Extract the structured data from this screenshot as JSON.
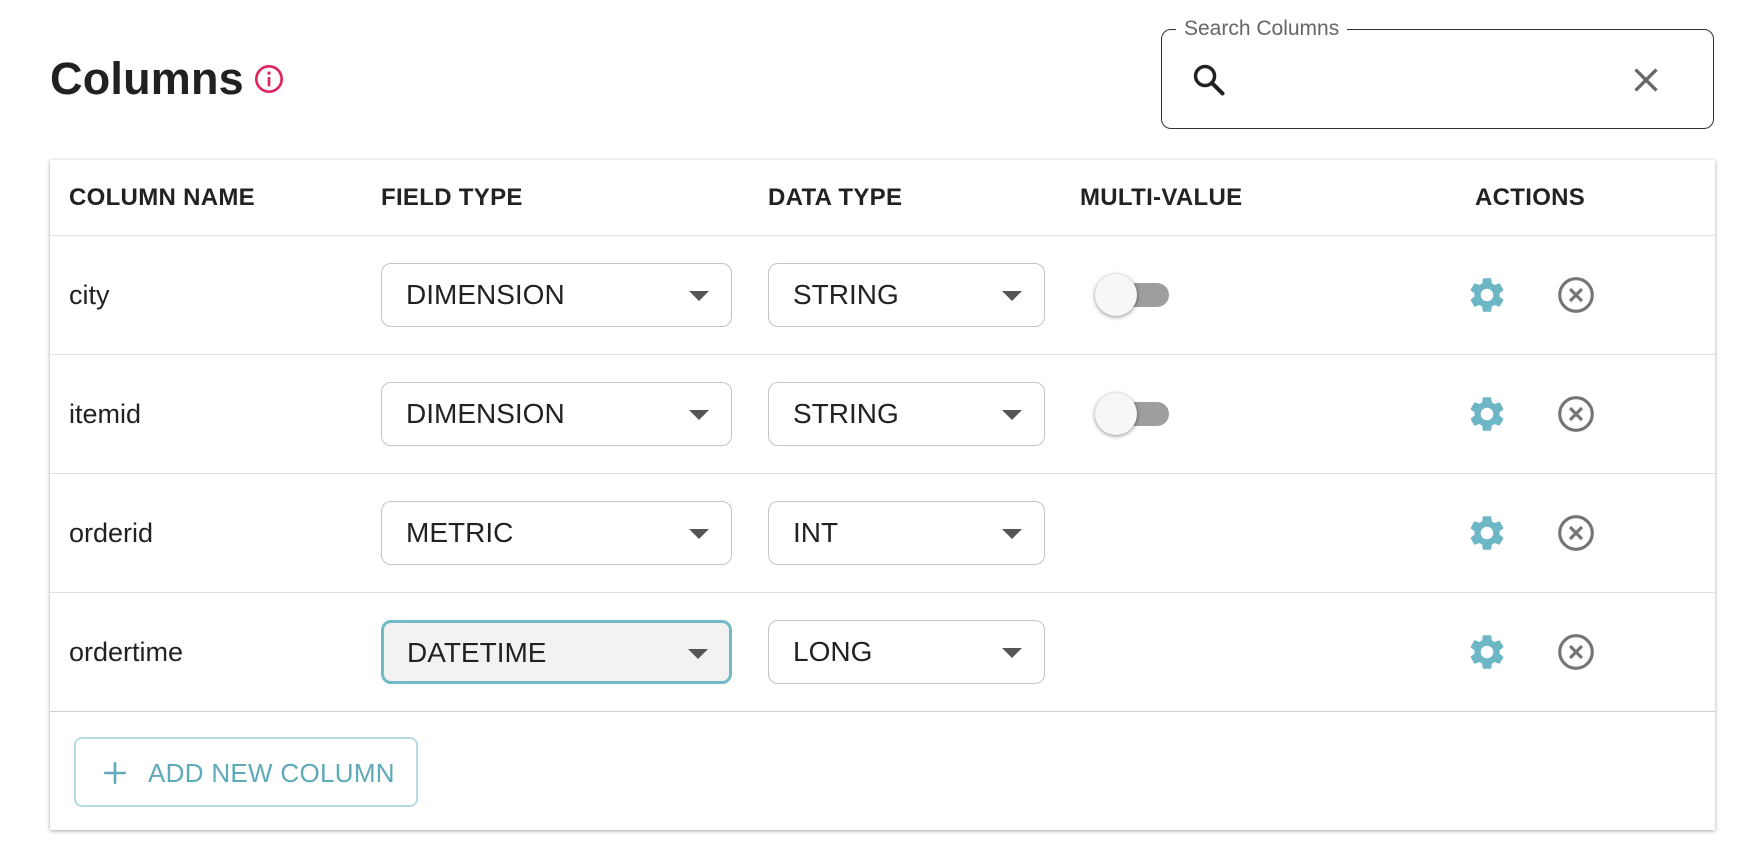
{
  "header": {
    "title": "Columns",
    "info_icon": "info-circle-icon"
  },
  "search": {
    "label": "Search Columns",
    "value": "",
    "placeholder": ""
  },
  "colors": {
    "accent": "#5eaab9",
    "info": "#e0245e",
    "toggle_off": "#9e9e9e"
  },
  "table": {
    "headers": {
      "column_name": "COLUMN NAME",
      "field_type": "FIELD TYPE",
      "data_type": "DATA TYPE",
      "multi_value": "MULTI-VALUE",
      "actions": "ACTIONS"
    },
    "rows": [
      {
        "name": "city",
        "field_type": "DIMENSION",
        "data_type": "STRING",
        "multi_value": false,
        "has_multi_value": true
      },
      {
        "name": "itemid",
        "field_type": "DIMENSION",
        "data_type": "STRING",
        "multi_value": false,
        "has_multi_value": true
      },
      {
        "name": "orderid",
        "field_type": "METRIC",
        "data_type": "INT",
        "has_multi_value": false
      },
      {
        "name": "ordertime",
        "field_type": "DATETIME",
        "data_type": "LONG",
        "has_multi_value": false,
        "focused_field": "field_type"
      }
    ]
  },
  "add_button": {
    "label": "ADD NEW COLUMN",
    "icon": "plus-icon"
  }
}
